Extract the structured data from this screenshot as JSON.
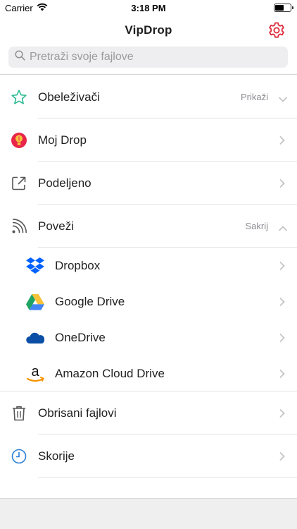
{
  "status": {
    "carrier": "Carrier",
    "time": "3:18 PM"
  },
  "nav": {
    "title": "VipDrop"
  },
  "search": {
    "placeholder": "Pretraži svoje fajlove"
  },
  "items": [
    {
      "label": "Obeleživači",
      "action": "Prikaži",
      "icon": "star-icon",
      "color": "#2bb991"
    },
    {
      "label": "Moj Drop",
      "icon": "balloon-icon",
      "color": "#e8264a"
    },
    {
      "label": "Podeljeno",
      "icon": "share-icon",
      "color": "#555555"
    },
    {
      "label": "Poveži",
      "action": "Sakrij",
      "icon": "rss-icon",
      "color": "#555555"
    }
  ],
  "connections": [
    {
      "label": "Dropbox",
      "icon": "dropbox-icon",
      "color": "#0061fe"
    },
    {
      "label": "Google Drive",
      "icon": "google-drive-icon"
    },
    {
      "label": "OneDrive",
      "icon": "onedrive-icon",
      "color": "#0a4ea5"
    },
    {
      "label": "Amazon Cloud Drive",
      "icon": "amazon-icon"
    }
  ],
  "bottom_items": [
    {
      "label": "Obrisani fajlovi",
      "icon": "trash-icon",
      "color": "#555555"
    },
    {
      "label": "Skorije",
      "icon": "clock-icon",
      "color": "#2a7fd4"
    }
  ],
  "accent": "#e02a3b"
}
